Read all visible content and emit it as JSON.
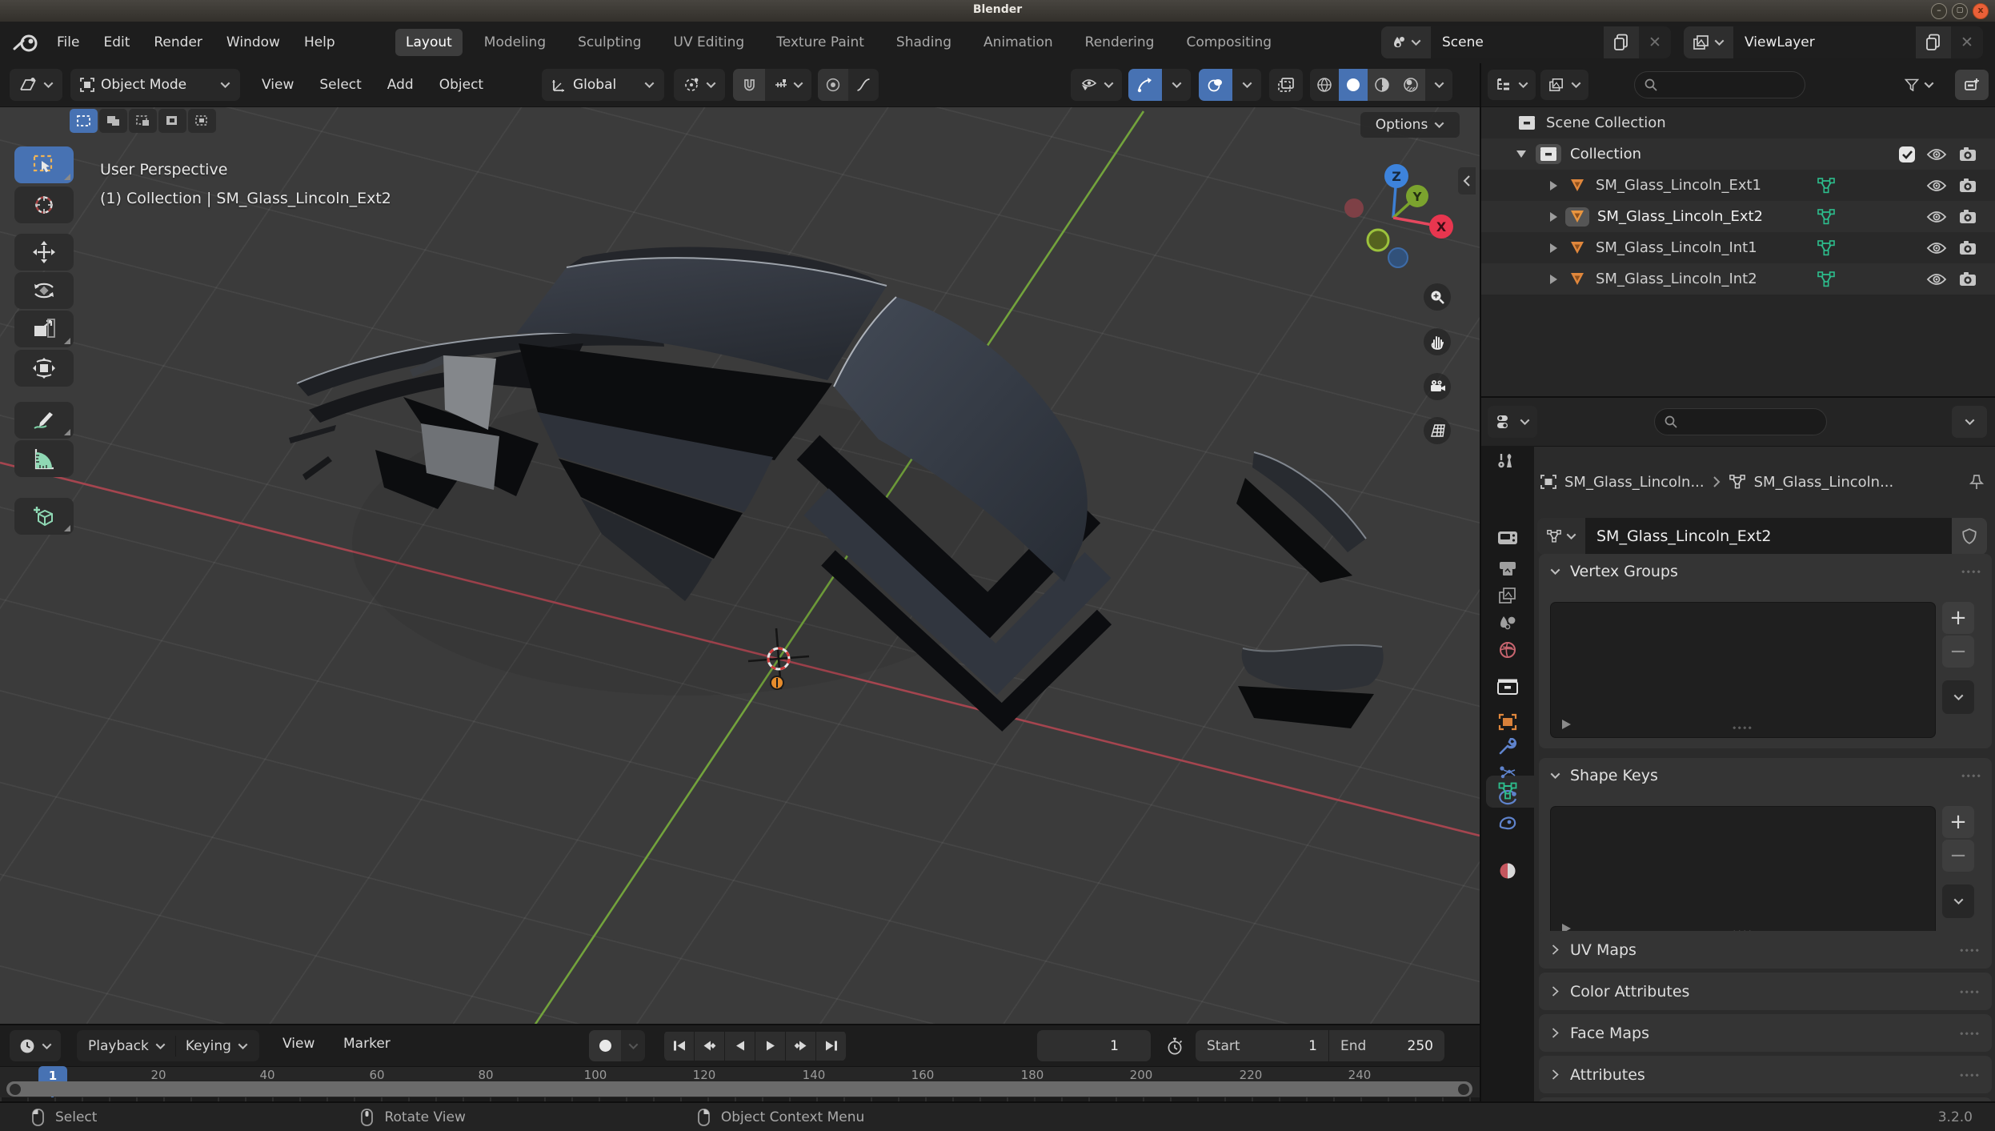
{
  "window": {
    "title": "Blender"
  },
  "topbar": {
    "menus": [
      "File",
      "Edit",
      "Render",
      "Window",
      "Help"
    ],
    "workspaces": [
      "Layout",
      "Modeling",
      "Sculpting",
      "UV Editing",
      "Texture Paint",
      "Shading",
      "Animation",
      "Rendering",
      "Compositing"
    ],
    "active_workspace": "Layout",
    "scene": "Scene",
    "view_layer": "ViewLayer"
  },
  "viewport": {
    "header": {
      "mode": "Object Mode",
      "menus": [
        "View",
        "Select",
        "Add",
        "Object"
      ],
      "orientation": "Global"
    },
    "options_label": "Options",
    "info_line1": "User Perspective",
    "info_line2": "(1) Collection | SM_Glass_Lincoln_Ext2",
    "gizmo": {
      "x": "X",
      "y": "Y",
      "z": "Z"
    }
  },
  "outliner": {
    "root_label": "Scene Collection",
    "collection_label": "Collection",
    "objects": [
      "SM_Glass_Lincoln_Ext1",
      "SM_Glass_Lincoln_Ext2",
      "SM_Glass_Lincoln_Int1",
      "SM_Glass_Lincoln_Int2"
    ],
    "active_object": "SM_Glass_Lincoln_Ext2"
  },
  "properties": {
    "breadcrumb": {
      "object": "SM_Glass_Lincoln...",
      "data": "SM_Glass_Lincoln..."
    },
    "datablock_name": "SM_Glass_Lincoln_Ext2",
    "panels": {
      "vertex_groups": "Vertex Groups",
      "shape_keys": "Shape Keys",
      "collapsed": [
        "UV Maps",
        "Color Attributes",
        "Face Maps",
        "Attributes"
      ]
    }
  },
  "timeline": {
    "menus": [
      "Playback",
      "Keying",
      "View",
      "Marker"
    ],
    "current_frame": "1",
    "start_label": "Start",
    "start_value": "1",
    "end_label": "End",
    "end_value": "250",
    "playhead_label": "1",
    "ticks": [
      "20",
      "40",
      "60",
      "80",
      "100",
      "120",
      "140",
      "160",
      "180",
      "200",
      "220",
      "240"
    ]
  },
  "statusbar": {
    "items": [
      "Select",
      "Rotate View",
      "Object Context Menu"
    ],
    "version": "3.2.0"
  },
  "colors": {
    "accent_blue": "#4772B3",
    "object_orange": "#E0873C",
    "mesh_green": "#2DBE8D",
    "axis_x_red": "#A5454F",
    "axis_y_green": "#73A33C",
    "close_button": "#EA6038"
  }
}
